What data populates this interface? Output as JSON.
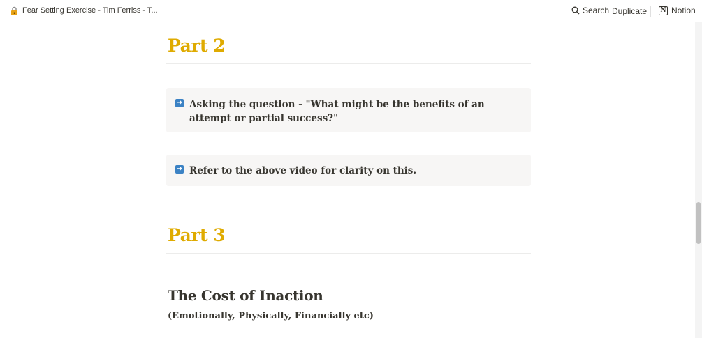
{
  "topbar": {
    "page_icon": "lock-icon",
    "page_title": "Fear Setting Exercise - Tim Ferriss - T...",
    "search_label": "Search",
    "duplicate_label": "Duplicate",
    "notion_label": "Notion"
  },
  "content": {
    "part2_heading": "Part 2",
    "callout1_icon": "arrow-right-icon",
    "callout1_text": "Asking the question - \"What might be the benefits of an attempt or partial success?\"",
    "callout2_icon": "arrow-right-icon",
    "callout2_text": "Refer to the above video for clarity on this.",
    "part3_heading": "Part 3",
    "cost_heading": "The Cost of Inaction",
    "cost_subtitle": "(Emotionally, Physically, Financially etc)"
  },
  "colors": {
    "heading_accent": "#dfab01",
    "callout_bg": "#f7f6f5",
    "arrow_icon": "#3b82c4"
  }
}
